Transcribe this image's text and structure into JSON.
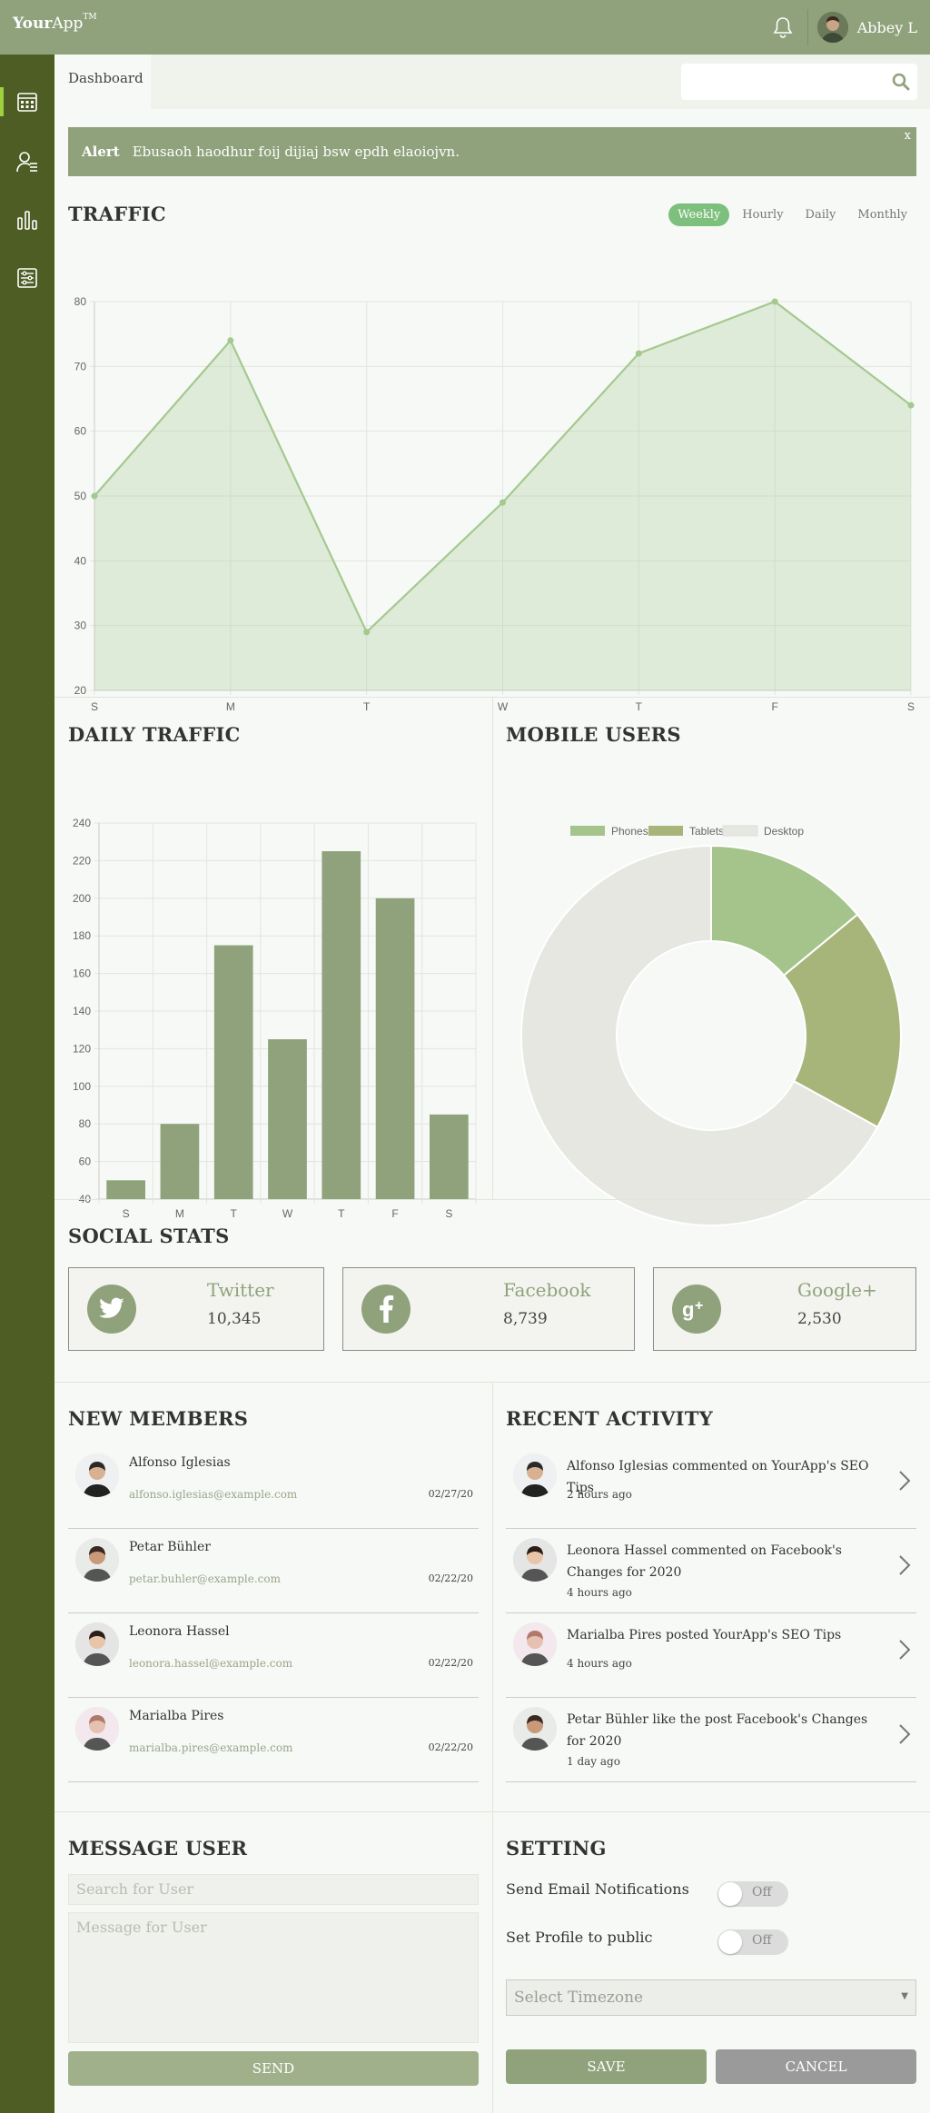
{
  "header": {
    "logo_bold": "Your",
    "logo_rest": "App",
    "logo_tm": "TM",
    "username": "Abbey L",
    "icons": [
      "bell-icon",
      "user-avatar"
    ]
  },
  "sidebar": {
    "items": [
      {
        "icon": "calendar-icon",
        "active": true
      },
      {
        "icon": "members-icon",
        "active": false
      },
      {
        "icon": "bar-chart-icon",
        "active": false
      },
      {
        "icon": "settings-sliders-icon",
        "active": false
      }
    ]
  },
  "breadcrumb": {
    "label": "Dashboard"
  },
  "search": {
    "placeholder": ""
  },
  "alert": {
    "title": "Alert",
    "message": "Ebusaoh haodhur foij dijiaj bsw epdh elaoiojvn.",
    "close": "x"
  },
  "traffic": {
    "title": "TRAFFIC",
    "tabs": [
      {
        "label": "Weekly",
        "active": true
      },
      {
        "label": "Hourly",
        "active": false
      },
      {
        "label": "Daily",
        "active": false
      },
      {
        "label": "Monthly",
        "active": false
      }
    ]
  },
  "daily_traffic": {
    "title": "DAILY TRAFFIC"
  },
  "mobile_users": {
    "title": "MOBILE USERS"
  },
  "chart_data": [
    {
      "type": "area",
      "categories": [
        "S",
        "M",
        "T",
        "W",
        "T",
        "F",
        "S"
      ],
      "values": [
        50,
        74,
        29,
        49,
        72,
        80,
        64
      ],
      "ylim": [
        20,
        80
      ],
      "yticks": [
        20,
        30,
        40,
        50,
        60,
        70,
        80
      ],
      "grid": true,
      "color": "#a4c98f"
    },
    {
      "type": "bar",
      "categories": [
        "S",
        "M",
        "T",
        "W",
        "T",
        "F",
        "S"
      ],
      "values": [
        50,
        80,
        175,
        125,
        225,
        200,
        85
      ],
      "ylim": [
        40,
        240
      ],
      "yticks": [
        40,
        60,
        80,
        100,
        120,
        140,
        160,
        180,
        200,
        220,
        240
      ],
      "grid": true,
      "color": "#8fa27c"
    },
    {
      "type": "pie",
      "donut": true,
      "legend_position": "top",
      "series": [
        {
          "name": "Phones",
          "value": 14,
          "color": "#a4c48c"
        },
        {
          "name": "Tablets",
          "value": 19,
          "color": "#a8b57a"
        },
        {
          "name": "Desktop",
          "value": 67,
          "color": "#e6e7e1"
        }
      ]
    }
  ],
  "social": {
    "title": "SOCIAL STATS",
    "items": [
      {
        "name": "Twitter",
        "count": "10,345",
        "icon": "twitter-icon"
      },
      {
        "name": "Facebook",
        "count": "8,739",
        "icon": "facebook-icon"
      },
      {
        "name": "Google+",
        "count": "2,530",
        "icon": "google-plus-icon"
      }
    ]
  },
  "members": {
    "title": "NEW MEMBERS",
    "items": [
      {
        "name": "Alfonso Iglesias",
        "email": "alfonso.iglesias@example.com",
        "date": "02/27/20"
      },
      {
        "name": "Petar Bühler",
        "email": "petar.buhler@example.com",
        "date": "02/22/20"
      },
      {
        "name": "Leonora Hassel",
        "email": "leonora.hassel@example.com",
        "date": "02/22/20"
      },
      {
        "name": "Marialba Pires",
        "email": "marialba.pires@example.com",
        "date": "02/22/20"
      }
    ]
  },
  "activity": {
    "title": "RECENT ACTIVITY",
    "items": [
      {
        "text": "Alfonso Iglesias commented on YourApp's SEO Tips",
        "time": "2 hours ago"
      },
      {
        "text": "Leonora Hassel commented on Facebook's Changes for 2020",
        "time": "4 hours ago"
      },
      {
        "text": "Marialba Pires posted YourApp's SEO Tips",
        "time": "4 hours ago"
      },
      {
        "text": "Petar Bühler like the post Facebook's Changes for 2020",
        "time": "1 day ago"
      }
    ]
  },
  "message": {
    "title": "MESSAGE USER",
    "search_placeholder": "Search for User",
    "message_placeholder": "Message for User",
    "send_label": "SEND"
  },
  "settings": {
    "title": "SETTING",
    "email_label": "Send Email Notifications",
    "email_state": "Off",
    "public_label": "Set Profile to public",
    "public_state": "Off",
    "timezone_placeholder": "Select Timezone",
    "save_label": "SAVE",
    "cancel_label": "CANCEL"
  }
}
